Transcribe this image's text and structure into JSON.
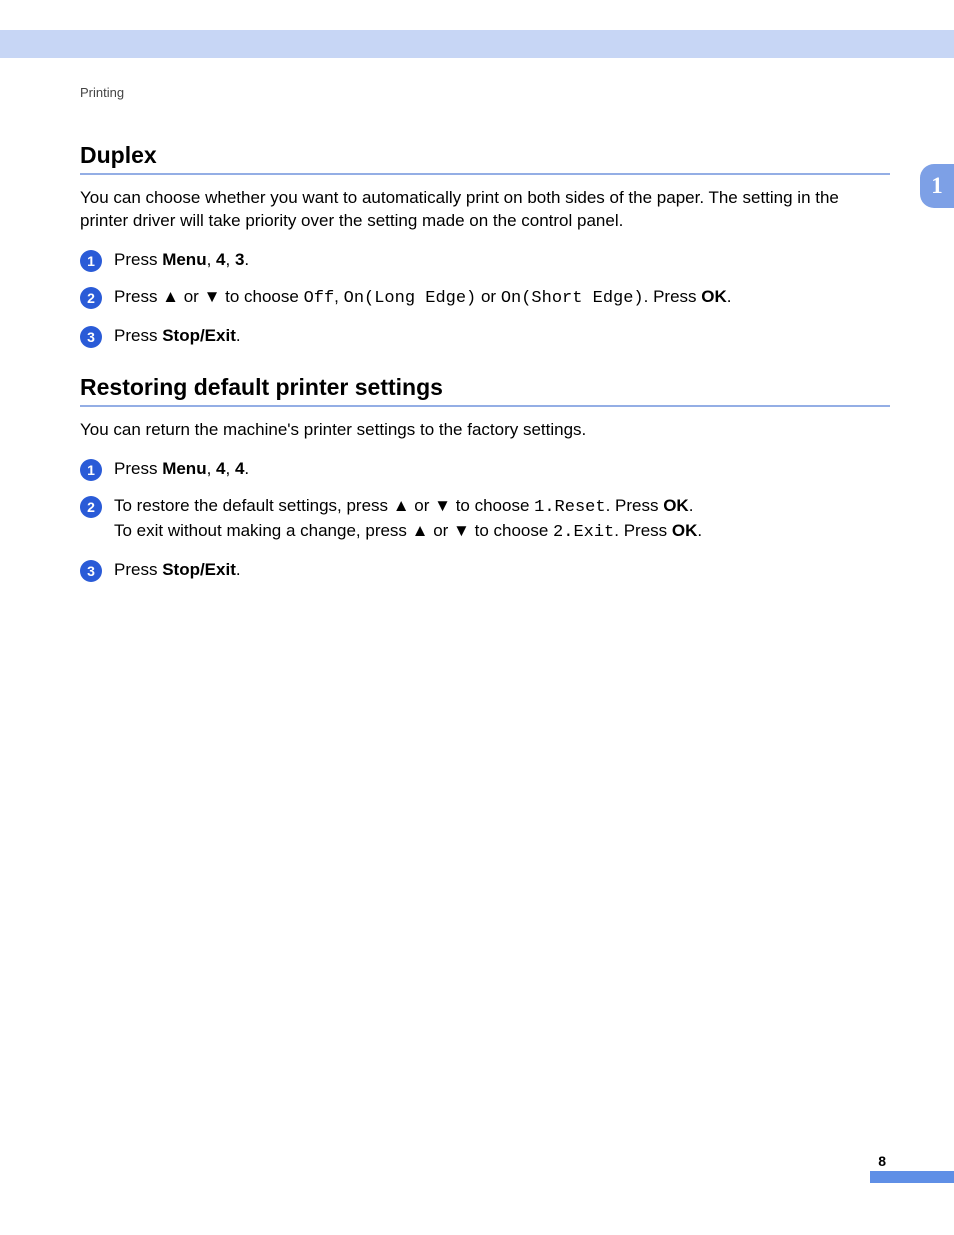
{
  "header": {
    "breadcrumb": "Printing"
  },
  "tab": {
    "chapter": "1"
  },
  "footer": {
    "page": "8"
  },
  "duplex": {
    "title": "Duplex",
    "intro": "You can choose whether you want to automatically print on both sides of the paper. The setting in the printer driver will take priority over the setting made on the control panel.",
    "steps": {
      "n1": "1",
      "n2": "2",
      "n3": "3",
      "s1_press": "Press ",
      "s1_menu": "Menu",
      "s1_c1": ", ",
      "s1_v1": "4",
      "s1_c2": ", ",
      "s1_v2": "3",
      "s1_dot": ".",
      "s2_pre": "Press ▲ or ▼ to choose ",
      "s2_opt1": "Off",
      "s2_c1": ", ",
      "s2_opt2": "On(Long Edge)",
      "s2_or": " or ",
      "s2_opt3": "On(Short Edge)",
      "s2_post1": ". Press ",
      "s2_ok": "OK",
      "s2_dot": ".",
      "s3_press": "Press ",
      "s3_stop": "Stop/Exit",
      "s3_dot": "."
    }
  },
  "restore": {
    "title": "Restoring default printer settings",
    "intro": "You can return the machine's printer settings to the factory settings.",
    "steps": {
      "n1": "1",
      "n2": "2",
      "n3": "3",
      "s1_press": "Press ",
      "s1_menu": "Menu",
      "s1_c1": ", ",
      "s1_v1": "4",
      "s1_c2": ", ",
      "s1_v2": "4",
      "s1_dot": ".",
      "s2_l1_pre": "To restore the default settings, press ▲ or ▼ to choose ",
      "s2_l1_opt": "1.Reset",
      "s2_l1_post1": ". Press ",
      "s2_l1_ok": "OK",
      "s2_l1_dot": ".",
      "s2_l2_pre": "To exit without making a change, press ▲ or ▼ to choose ",
      "s2_l2_opt": "2.Exit",
      "s2_l2_post1": ". Press ",
      "s2_l2_ok": "OK",
      "s2_l2_dot": ".",
      "s3_press": "Press ",
      "s3_stop": "Stop/Exit",
      "s3_dot": "."
    }
  }
}
